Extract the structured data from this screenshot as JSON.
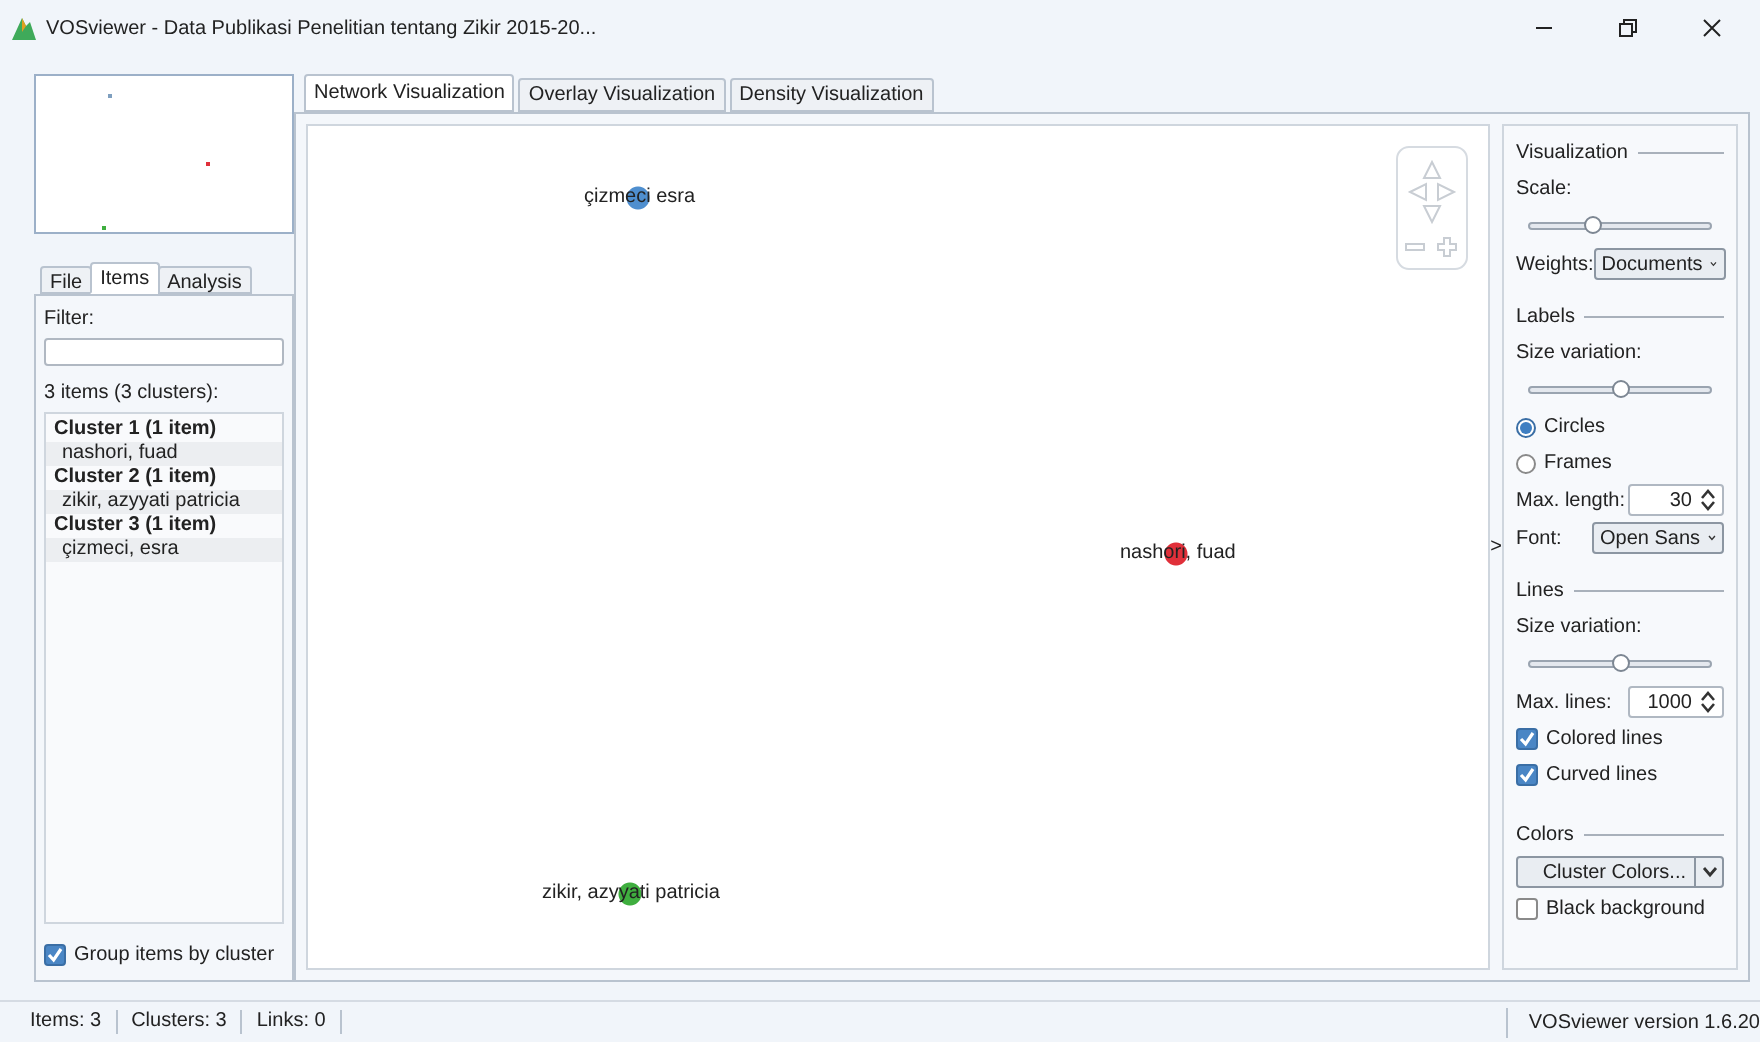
{
  "window": {
    "title": "VOSviewer - Data Publikasi Penelitian tentang Zikir 2015-20..."
  },
  "overview": {
    "dots": [
      {
        "color": "#7f9fbf"
      },
      {
        "color": "#e0303a"
      },
      {
        "color": "#3fae3f"
      }
    ]
  },
  "left_tabs": [
    {
      "label": "File",
      "selected": false
    },
    {
      "label": "Items",
      "selected": true
    },
    {
      "label": "Analysis",
      "selected": false
    }
  ],
  "filter": {
    "label": "Filter:"
  },
  "items_summary": "3 items (3 clusters):",
  "clusters": [
    {
      "label": "Cluster 1 (1 item)",
      "items": [
        "nashori, fuad"
      ]
    },
    {
      "label": "Cluster 2 (1 item)",
      "items": [
        "zikir, azyyati patricia"
      ]
    },
    {
      "label": "Cluster 3 (1 item)",
      "items": [
        "çizmeci, esra"
      ]
    }
  ],
  "group_by_cluster": {
    "label": "Group items by cluster",
    "checked": true
  },
  "main_tabs": [
    {
      "label": "Network Visualization",
      "selected": true
    },
    {
      "label": "Overlay Visualization",
      "selected": false
    },
    {
      "label": "Density Visualization",
      "selected": false
    }
  ],
  "network": {
    "nodes": [
      {
        "label": "çizmeci esra",
        "color": "#4f8fcf"
      },
      {
        "label": "nashori, fuad",
        "color": "#e0303a"
      },
      {
        "label": "zikir, azyyati patricia",
        "color": "#3fae3f"
      }
    ]
  },
  "panel_toggle": ">",
  "settings": {
    "visualization": {
      "title": "Visualization",
      "scale_label": "Scale:",
      "scale": {
        "level": 0.35
      },
      "weights_label": "Weights:",
      "weights": "Documents"
    },
    "labels": {
      "title": "Labels",
      "size_label": "Size variation:",
      "size": {
        "level": 0.5
      },
      "shapes": [
        {
          "label": "Circles",
          "selected": true
        },
        {
          "label": "Frames",
          "selected": false
        }
      ],
      "max_length_label": "Max. length:",
      "max_length": "30",
      "font_label": "Font:",
      "font": "Open Sans"
    },
    "lines": {
      "title": "Lines",
      "size_label": "Size variation:",
      "size": {
        "level": 0.5
      },
      "max_lines_label": "Max. lines:",
      "max_lines": "1000",
      "options": [
        {
          "label": "Colored lines",
          "checked": true
        },
        {
          "label": "Curved lines",
          "checked": true
        }
      ]
    },
    "colors": {
      "title": "Colors",
      "button": "Cluster Colors...",
      "options": [
        {
          "label": "Black background",
          "checked": false
        }
      ]
    }
  },
  "status_bar": {
    "fields": [
      "Items: 3",
      "Clusters: 3",
      "Links: 0"
    ],
    "version": "VOSviewer version 1.6.20"
  }
}
